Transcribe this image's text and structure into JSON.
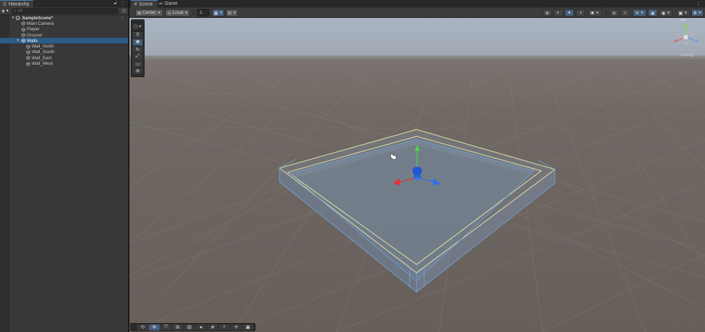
{
  "hierarchy": {
    "tab_label": "Hierarchy",
    "search_placeholder": "All",
    "scene_name": "SampleScene*",
    "items": [
      {
        "label": "Main Camera"
      },
      {
        "label": "Player"
      },
      {
        "label": "Ground"
      },
      {
        "label": "Walls"
      },
      {
        "label": "Wall_North"
      },
      {
        "label": "Wall_South"
      },
      {
        "label": "Wall_East"
      },
      {
        "label": "Wall_West"
      }
    ]
  },
  "scene": {
    "tabs": [
      {
        "label": "Scene",
        "icon": "grid-icon"
      },
      {
        "label": "Game",
        "icon": "gamepad-icon"
      }
    ],
    "toolbar": {
      "pivot_label": "Center",
      "space_label": "Local",
      "snap_value": "1"
    },
    "projection_label": "< Persp"
  },
  "colors": {
    "accent": "#4a88c5",
    "selection": "#2c5d87",
    "sky": "#a4b0be",
    "ground": "#6d6560"
  }
}
